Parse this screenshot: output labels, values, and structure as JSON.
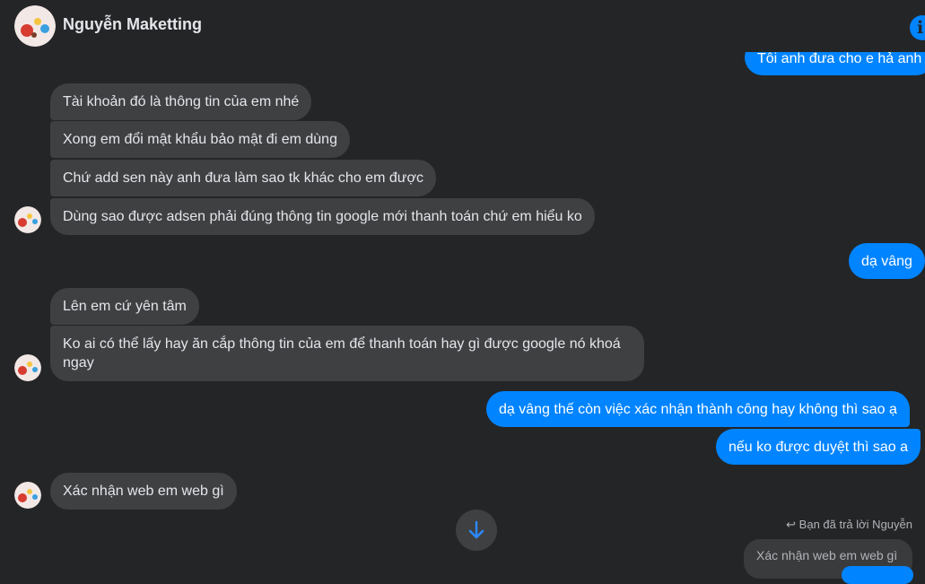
{
  "header": {
    "contact_name": "Nguyễn Maketting",
    "info_icon": "info-icon"
  },
  "messages": {
    "top_cut": "Tôi anh đưa cho e hả anh",
    "in1": "Tài khoản đó là thông tin của em nhé",
    "in2": "Xong em đổi mật khẩu bảo mật đi em dùng",
    "in3": "Chứ add sen này anh đưa làm sao tk khác cho em được",
    "in4": "Dùng sao được adsen phải đúng thông tin google mới thanh toán chứ em hiểu ko",
    "out1": "dạ vâng",
    "in5": "Lên em cứ yên tâm",
    "in6": "Ko ai có thể lấy hay ăn cắp thông tin của em để thanh toán hay gì được google nó khoá ngay",
    "out2": "dạ vâng thế còn việc xác nhận thành công hay không thì sao ạ",
    "out3": "nếu ko được duyệt thì sao a",
    "in7": "Xác nhận web em web gì"
  },
  "reply": {
    "note": "Bạn đã trả lời Nguyễn",
    "quoted": "Xác nhận web em web gì"
  },
  "colors": {
    "background": "#242526",
    "incoming_bubble": "#3e4042",
    "outgoing_bubble": "#0084ff"
  }
}
